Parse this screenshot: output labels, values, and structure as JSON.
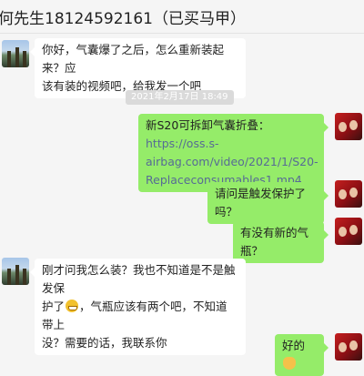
{
  "header": {
    "title": "何先生18124592161（已买马甲）"
  },
  "timestamp": "2021年2月17日  18:49",
  "messages": [
    {
      "side": "in",
      "lines": [
        "你好，气囊爆了之后，怎么重新装起来？应",
        "该有装的视频吧，给我发一个吧"
      ]
    },
    {
      "side": "out",
      "prefix": "新S20可拆卸气囊折叠：",
      "link_lines": [
        "https://oss.s-",
        "airbag.com/video/2021/1/S20-",
        "Replaceconsumables1.mp4"
      ]
    },
    {
      "side": "out",
      "text": "请问是触发保护了吗？"
    },
    {
      "side": "out",
      "text": "有没有新的气瓶？"
    },
    {
      "side": "in",
      "lines": [
        "刚才问我怎么装？我也不知道是不是触发保",
        "护了",
        "，气瓶应该有两个吧，不知道带上",
        "没？需要的话，我联系你"
      ],
      "emoji": "grin-emoji"
    },
    {
      "side": "out",
      "text": "好的",
      "emoji": "ok-hand-emoji"
    }
  ]
}
